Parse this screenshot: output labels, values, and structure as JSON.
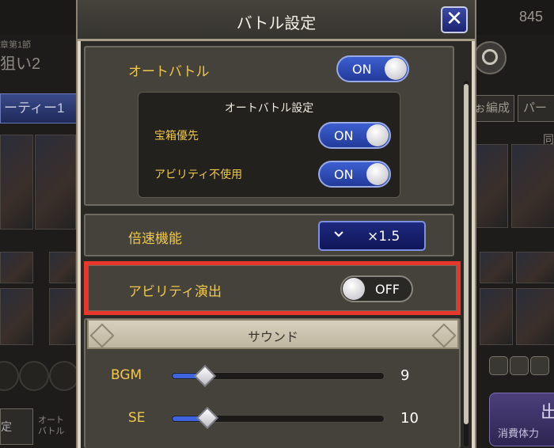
{
  "background": {
    "counter": "845",
    "chapter": "章第1節",
    "stage": "狙い2",
    "party_tab": "ーティー1",
    "btn_reorg": "ぉ編成",
    "btn_party": "パー",
    "side_label": "同",
    "bottom_left_label": "定",
    "auto_label": "オート\nバトル",
    "start_title": "出",
    "start_sub": "消費体力"
  },
  "dialog": {
    "title": "バトル設定",
    "close_label": "✕",
    "auto_battle": {
      "label": "オートバトル",
      "toggle": "ON",
      "state": true
    },
    "auto_settings": {
      "title": "オートバトル設定",
      "treasure_priority": {
        "label": "宝箱優先",
        "toggle": "ON",
        "state": true
      },
      "no_ability": {
        "label": "アビリティ不使用",
        "toggle": "ON",
        "state": true
      }
    },
    "speed": {
      "label": "倍速機能",
      "value": "×1.5",
      "chevron": "chevron-down-icon"
    },
    "ability_effects": {
      "label": "アビリティ演出",
      "toggle": "OFF",
      "state": false
    },
    "sound": {
      "title": "サウンド",
      "bgm": {
        "label": "BGM",
        "value": "9",
        "level": 0.09
      },
      "se": {
        "label": "SE",
        "value": "10",
        "level": 0.1
      }
    }
  },
  "colors": {
    "accent_on": "#3d5fd0",
    "label_gold": "#f0c84a",
    "highlight_red": "#e8362a"
  }
}
